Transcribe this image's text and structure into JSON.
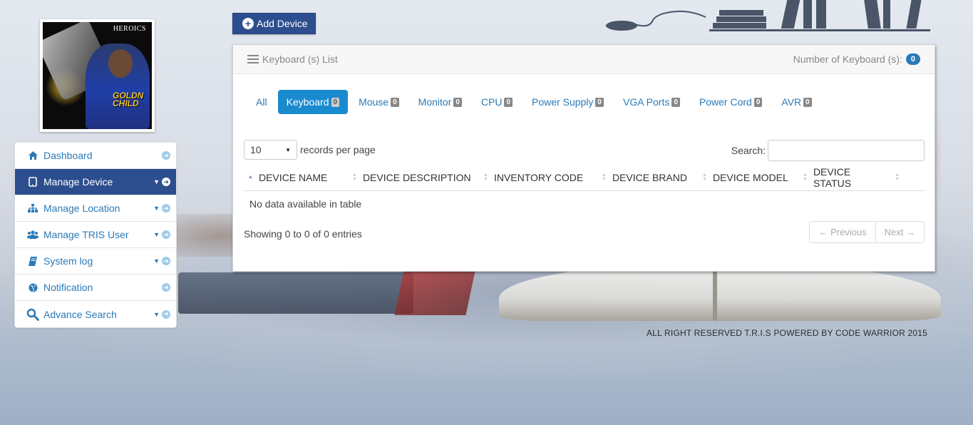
{
  "sidebar": {
    "items": [
      {
        "label": "Dashboard",
        "icon": "home-icon"
      },
      {
        "label": "Manage Device",
        "icon": "tablet-icon"
      },
      {
        "label": "Manage Location",
        "icon": "sitemap-icon"
      },
      {
        "label": "Manage TRIS User",
        "icon": "users-icon"
      },
      {
        "label": "System log",
        "icon": "book-icon"
      },
      {
        "label": "Notification",
        "icon": "globe-icon"
      },
      {
        "label": "Advance Search",
        "icon": "search-icon"
      }
    ]
  },
  "avatar": {
    "brand": "HEROICS",
    "caption": "GOLDN CHILD"
  },
  "toolbar": {
    "add_device_label": "Add Device"
  },
  "panel": {
    "title": "Keyboard (s) List",
    "count_label": "Number of Keyboard (s):",
    "count": "0"
  },
  "tabs": [
    {
      "label": "All",
      "badge": ""
    },
    {
      "label": "Keyboard",
      "badge": "0"
    },
    {
      "label": "Mouse",
      "badge": "0"
    },
    {
      "label": "Monitor",
      "badge": "0"
    },
    {
      "label": "CPU",
      "badge": "0"
    },
    {
      "label": "Power Supply",
      "badge": "0"
    },
    {
      "label": "VGA Ports",
      "badge": "0"
    },
    {
      "label": "Power Cord",
      "badge": "0"
    },
    {
      "label": "AVR",
      "badge": "0"
    }
  ],
  "table": {
    "length_value": "10",
    "length_suffix": "records per page",
    "search_label": "Search:",
    "columns": [
      "DEVICE NAME",
      "DEVICE DESCRIPTION",
      "INVENTORY CODE",
      "DEVICE BRAND",
      "DEVICE MODEL",
      "DEVICE STATUS"
    ],
    "empty_text": "No data available in table",
    "info": "Showing 0 to 0 of 0 entries",
    "prev_label": "← Previous",
    "next_label": "Next →"
  },
  "footer": {
    "text": "ALL RIGHT RESERVED T.R.I.S POWERED BY CODE WARRIOR 2015"
  },
  "colors": {
    "brand": "#2d4e8e",
    "accent": "#1a8acf",
    "link": "#2a7ab8"
  }
}
